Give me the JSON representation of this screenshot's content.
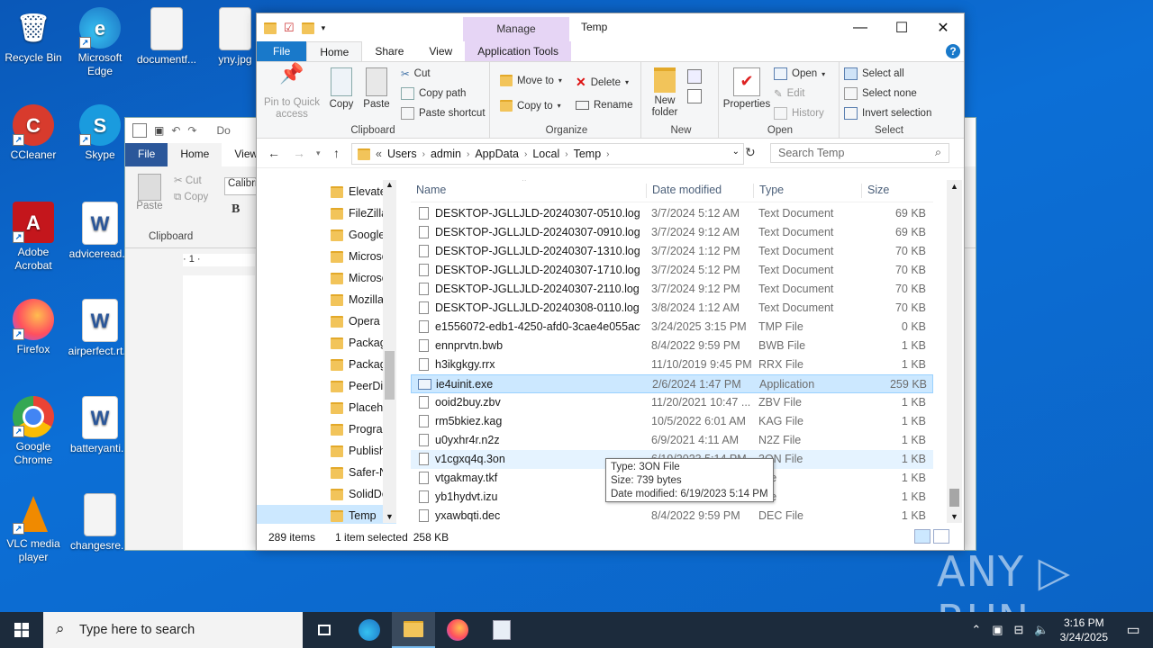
{
  "desktop": {
    "icons": [
      {
        "label": "Recycle Bin",
        "glyph": "🗑",
        "color": "#5aa0d8"
      },
      {
        "label": "Microsoft Edge",
        "glyph": "e",
        "color": "#1f8fd6"
      },
      {
        "label": "documentf...",
        "glyph": "▭",
        "color": "#e8e8e8"
      },
      {
        "label": "yny.jpg",
        "glyph": "▭",
        "color": "#e8e8e8"
      },
      {
        "label": "CCleaner",
        "glyph": "C",
        "color": "#d83b2d"
      },
      {
        "label": "Skype",
        "glyph": "S",
        "color": "#1a9bde"
      },
      {
        "label": "Adobe Acrobat",
        "glyph": "A",
        "color": "#c4161c"
      },
      {
        "label": "adviceread...",
        "glyph": "W",
        "color": "#2b579a"
      },
      {
        "label": "Firefox",
        "glyph": "◉",
        "color": "#ff7139"
      },
      {
        "label": "airperfect.rt...",
        "glyph": "W",
        "color": "#2b579a"
      },
      {
        "label": "Google Chrome",
        "glyph": "◉",
        "color": "#34a853"
      },
      {
        "label": "batteryanti...",
        "glyph": "W",
        "color": "#2b579a"
      },
      {
        "label": "VLC media player",
        "glyph": "▲",
        "color": "#f08a00"
      },
      {
        "label": "changesre...",
        "glyph": "▭",
        "color": "#e8e8e8"
      }
    ],
    "watermark": "ANY ▷ RUN"
  },
  "word": {
    "tabs": [
      "File",
      "Home",
      "View"
    ],
    "qat_title": "Do",
    "paste": "Paste",
    "cut": "Cut",
    "copy": "Copy",
    "font": "Calibri",
    "bold": "B",
    "clipboard": "Clipboard",
    "ruler": "· 1 ·"
  },
  "explorer": {
    "title": "Temp",
    "manage": "Manage",
    "tabs": {
      "file": "File",
      "home": "Home",
      "share": "Share",
      "view": "View",
      "apptools": "Application Tools"
    },
    "help": "?",
    "ribbon": {
      "pin": "Pin to Quick access",
      "copy": "Copy",
      "paste": "Paste",
      "cut": "Cut",
      "copy_path": "Copy path",
      "paste_shortcut": "Paste shortcut",
      "clipboard": "Clipboard",
      "move_to": "Move to",
      "copy_to": "Copy to",
      "delete": "Delete",
      "rename": "Rename",
      "organize": "Organize",
      "new_folder": "New folder",
      "new": "New",
      "properties": "Properties",
      "open": "Open",
      "edit": "Edit",
      "history": "History",
      "open_group": "Open",
      "select_all": "Select all",
      "select_none": "Select none",
      "invert_selection": "Invert selection",
      "select": "Select"
    },
    "address": {
      "prefix": "«",
      "crumbs": [
        "Users",
        "admin",
        "AppData",
        "Local",
        "Temp"
      ],
      "search_placeholder": "Search Temp"
    },
    "nav_items": [
      "Elevate",
      "FileZilla",
      "Google",
      "Microso",
      "Microso",
      "Mozilla",
      "Opera",
      "Packag",
      "Packag",
      "PeerDis",
      "Placeho",
      "Progran",
      "Publish",
      "Safer-N",
      "SolidDo",
      "Temp"
    ],
    "columns": {
      "name": "Name",
      "date": "Date modified",
      "type": "Type",
      "size": "Size"
    },
    "files": [
      {
        "name": "DESKTOP-JGLLJLD-20240307-0510.log",
        "date": "3/7/2024 5:12 AM",
        "type": "Text Document",
        "size": "69 KB"
      },
      {
        "name": "DESKTOP-JGLLJLD-20240307-0910.log",
        "date": "3/7/2024 9:12 AM",
        "type": "Text Document",
        "size": "69 KB"
      },
      {
        "name": "DESKTOP-JGLLJLD-20240307-1310.log",
        "date": "3/7/2024 1:12 PM",
        "type": "Text Document",
        "size": "70 KB"
      },
      {
        "name": "DESKTOP-JGLLJLD-20240307-1710.log",
        "date": "3/7/2024 5:12 PM",
        "type": "Text Document",
        "size": "70 KB"
      },
      {
        "name": "DESKTOP-JGLLJLD-20240307-2110.log",
        "date": "3/7/2024 9:12 PM",
        "type": "Text Document",
        "size": "70 KB"
      },
      {
        "name": "DESKTOP-JGLLJLD-20240308-0110.log",
        "date": "3/8/2024 1:12 AM",
        "type": "Text Document",
        "size": "70 KB"
      },
      {
        "name": "e1556072-edb1-4250-afd0-3cae4e055acf....",
        "date": "3/24/2025 3:15 PM",
        "type": "TMP File",
        "size": "0 KB"
      },
      {
        "name": "ennprvtn.bwb",
        "date": "8/4/2022 9:59 PM",
        "type": "BWB File",
        "size": "1 KB"
      },
      {
        "name": "h3ikgkgy.rrx",
        "date": "11/10/2019 9:45 PM",
        "type": "RRX File",
        "size": "1 KB"
      },
      {
        "name": "ie4uinit.exe",
        "date": "2/6/2024 1:47 PM",
        "type": "Application",
        "size": "259 KB"
      },
      {
        "name": "ooid2buy.zbv",
        "date": "11/20/2021 10:47 ...",
        "type": "ZBV File",
        "size": "1 KB"
      },
      {
        "name": "rm5bkiez.kag",
        "date": "10/5/2022 6:01 AM",
        "type": "KAG File",
        "size": "1 KB"
      },
      {
        "name": "u0yxhr4r.n2z",
        "date": "6/9/2021 4:11 AM",
        "type": "N2Z File",
        "size": "1 KB"
      },
      {
        "name": "v1cgxq4q.3on",
        "date": "6/19/2023 5:14 PM",
        "type": "3ON File",
        "size": "1 KB"
      },
      {
        "name": "vtgakmay.tkf",
        "date": "",
        "type": "File",
        "size": "1 KB"
      },
      {
        "name": "yb1hydvt.izu",
        "date": "",
        "type": "File",
        "size": "1 KB"
      },
      {
        "name": "yxawbqti.dec",
        "date": "8/4/2022 9:59 PM",
        "type": "DEC File",
        "size": "1 KB"
      }
    ],
    "status": {
      "count": "289 items",
      "selected": "1 item selected",
      "size": "258 KB"
    },
    "tooltip": {
      "line1": "Type: 3ON File",
      "line2": "Size: 739 bytes",
      "line3": "Date modified: 6/19/2023 5:14 PM"
    }
  },
  "taskbar": {
    "search_placeholder": "Type here to search",
    "time": "3:16 PM",
    "date": "3/24/2025"
  }
}
